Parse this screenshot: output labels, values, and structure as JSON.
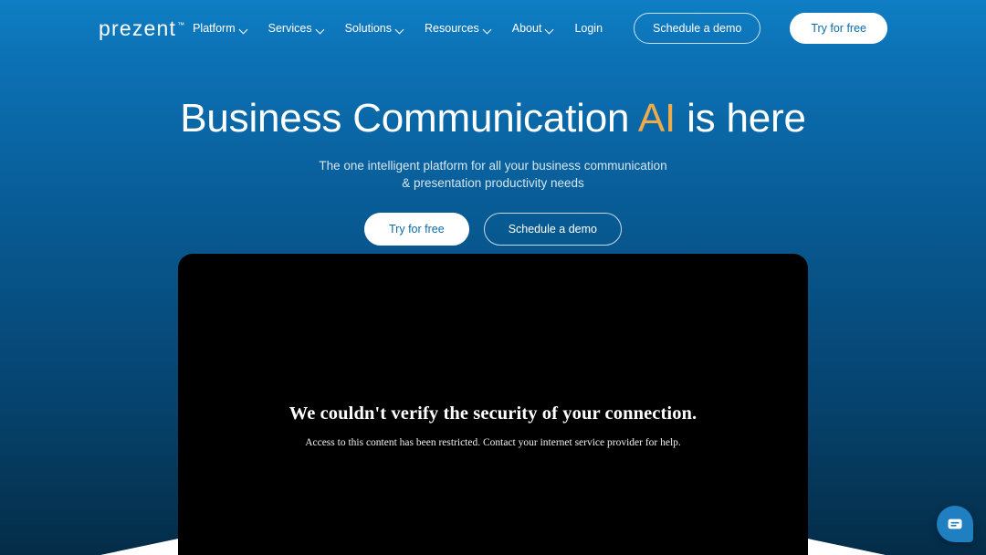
{
  "header": {
    "logo_text": "prezent",
    "logo_tm": "™",
    "nav_items": [
      {
        "label": "Platform",
        "has_chevron": true,
        "icon": "chevron-down-icon"
      },
      {
        "label": "Services",
        "has_chevron": true,
        "icon": "chevron-down-icon"
      },
      {
        "label": "Solutions",
        "has_chevron": true,
        "icon": "chevron-down-icon"
      },
      {
        "label": "Resources",
        "has_chevron": true,
        "icon": "chevron-down-icon"
      },
      {
        "label": "About",
        "has_chevron": true,
        "icon": "chevron-down-icon"
      },
      {
        "label": "Login",
        "has_chevron": false,
        "icon": ""
      }
    ],
    "demo_button": "Schedule a demo",
    "trial_button": "Try for free"
  },
  "hero": {
    "title_part1": "Business Communication ",
    "title_accent": "AI",
    "title_part2": " is here",
    "subtitle_line1": "The one intelligent platform for all your business communication",
    "subtitle_line2": "& presentation productivity needs",
    "primary_cta": "Try for free",
    "secondary_cta": "Schedule a demo"
  },
  "embedded_frame": {
    "error_title": "We couldn't verify the security of your connection.",
    "error_description": "Access to this content has been restricted. Contact your internet service provider for help."
  },
  "chat": {
    "icon": "chat-bubble-icon"
  },
  "colors": {
    "gradient_top": "#0f7ec4",
    "gradient_bottom": "#042c48",
    "accent_gold": "#eeab4c",
    "button_text_blue": "#0b6ba8",
    "chat_blue": "#1f7fc0",
    "frame_background": "#000000",
    "wedge_white": "#ffffff"
  }
}
